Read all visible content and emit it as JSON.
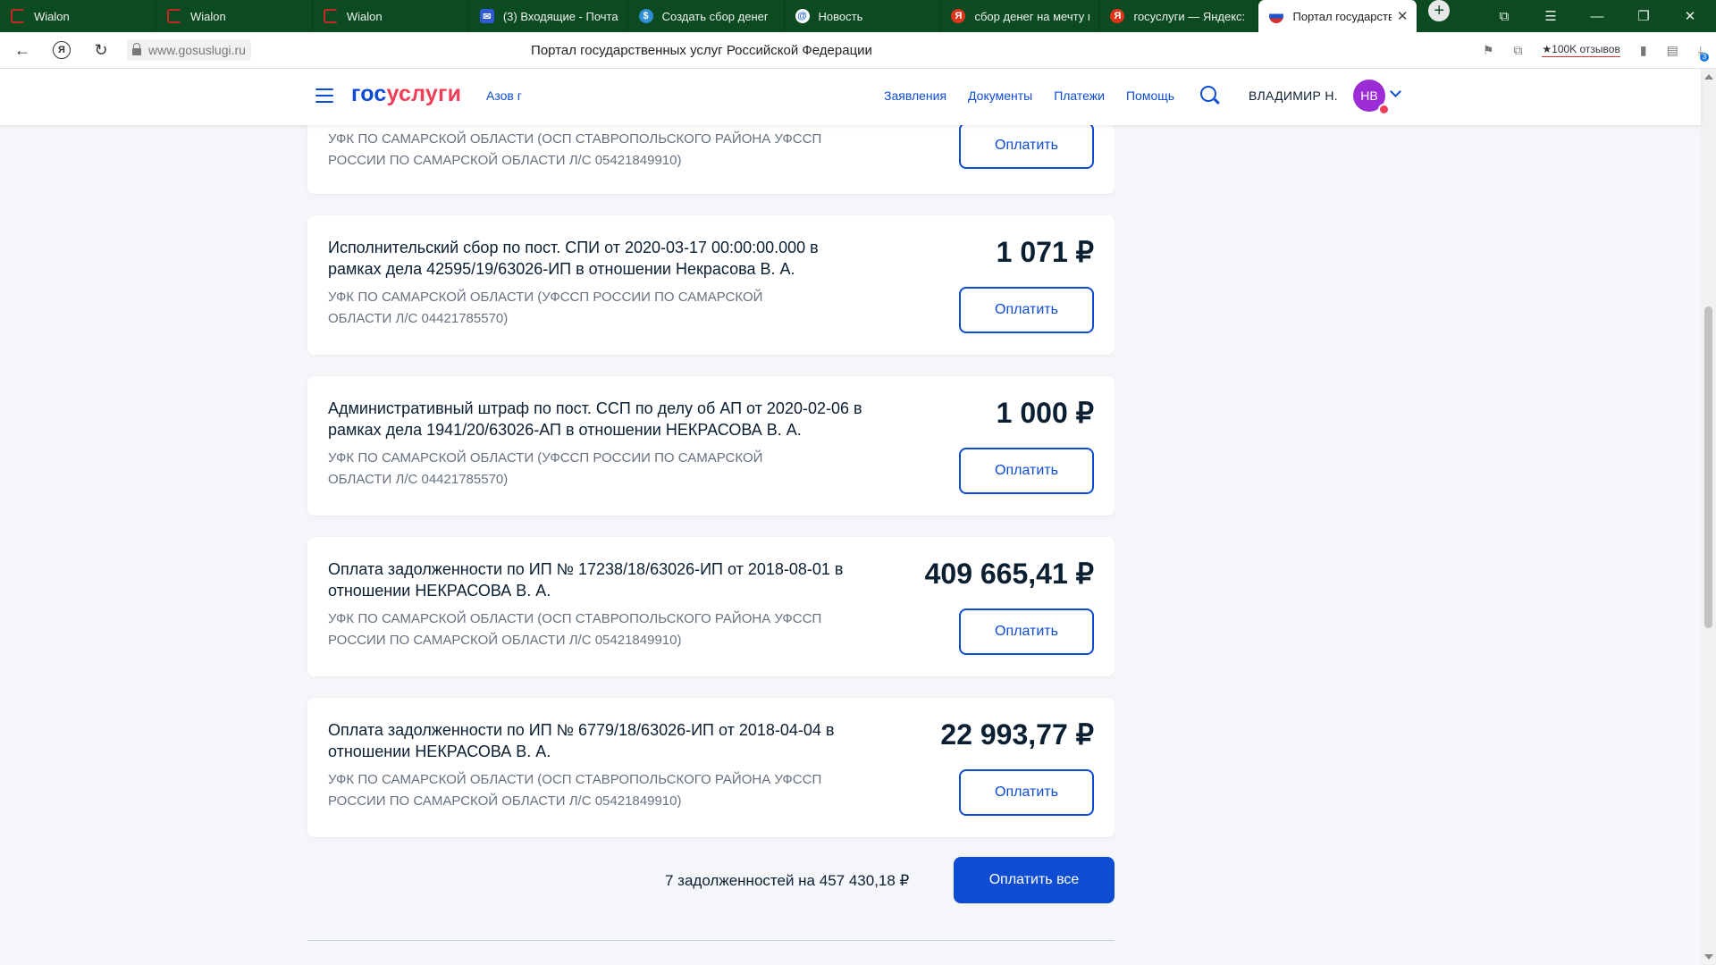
{
  "browser": {
    "tabs": [
      {
        "label": "Wialon",
        "icon": "wialon-icon"
      },
      {
        "label": "Wialon",
        "icon": "wialon-icon"
      },
      {
        "label": "Wialon",
        "icon": "wialon-icon"
      },
      {
        "label": "(3) Входящие - Почта",
        "icon": "mail-icon"
      },
      {
        "label": "Создать сбор денег",
        "icon": "donate-icon"
      },
      {
        "label": "Новость",
        "icon": "at-icon"
      },
      {
        "label": "сбор денег на мечту п",
        "icon": "yandex-icon"
      },
      {
        "label": "госуслуги — Яндекс: н",
        "icon": "yandex-icon"
      },
      {
        "label": "Портал государстве",
        "icon": "flag-icon",
        "active": true
      }
    ],
    "url": "www.gosuslugi.ru",
    "page_title": "Портал государственных услуг Российской Федерации",
    "reviews": "★100K отзывов",
    "downloads_count": "3"
  },
  "header": {
    "logo_part1": "гос",
    "logo_part2": "услуги",
    "location": "Азов г",
    "nav": [
      "Заявления",
      "Документы",
      "Платежи",
      "Помощь"
    ],
    "user_name": "ВЛАДИМИР Н.",
    "avatar_initials": "НВ"
  },
  "debts": [
    {
      "title": "",
      "recipient": "УФК ПО САМАРСКОЙ ОБЛАСТИ (ОСП СТАВРОПОЛЬСКОГО РАЙОНА УФССП РОССИИ ПО САМАРСКОЙ ОБЛАСТИ Л/С 05421849910)",
      "amount": "",
      "pay_label": "Оплатить"
    },
    {
      "title": "Исполнительский сбор по пост. СПИ от 2020-03-17 00:00:00.000 в рамках дела 42595/19/63026-ИП в отношении Некрасова В. А.",
      "recipient": "УФК ПО САМАРСКОЙ ОБЛАСТИ (УФССП РОССИИ ПО САМАРСКОЙ ОБЛАСТИ Л/С 04421785570)",
      "amount": "1 071 ₽",
      "pay_label": "Оплатить"
    },
    {
      "title": "Административный штраф по пост. ССП по делу об АП от 2020-02-06 в рамках дела 1941/20/63026-АП в отношении НЕКРАСОВА В. А.",
      "recipient": "УФК ПО САМАРСКОЙ ОБЛАСТИ (УФССП РОССИИ ПО САМАРСКОЙ ОБЛАСТИ Л/С 04421785570)",
      "amount": "1 000 ₽",
      "pay_label": "Оплатить"
    },
    {
      "title": "Оплата задолженности по ИП № 17238/18/63026-ИП от 2018-08-01 в отношении НЕКРАСОВА В. А.",
      "recipient": "УФК ПО САМАРСКОЙ ОБЛАСТИ (ОСП СТАВРОПОЛЬСКОГО РАЙОНА УФССП РОССИИ ПО САМАРСКОЙ ОБЛАСТИ Л/С 05421849910)",
      "amount": "409 665,41 ₽",
      "pay_label": "Оплатить"
    },
    {
      "title": "Оплата задолженности по ИП № 6779/18/63026-ИП от 2018-04-04 в отношении НЕКРАСОВА В. А.",
      "recipient": "УФК ПО САМАРСКОЙ ОБЛАСТИ (ОСП СТАВРОПОЛЬСКОГО РАЙОНА УФССП РОССИИ ПО САМАРСКОЙ ОБЛАСТИ Л/С 05421849910)",
      "amount": "22 993,77 ₽",
      "pay_label": "Оплатить"
    }
  ],
  "summary": {
    "text": "7 задолженностей на 457 430,18 ₽",
    "pay_all_label": "Оплатить все"
  },
  "colors": {
    "brand_blue": "#0d4cd3",
    "brand_red": "#ee3f58",
    "browser_frame": "#0c4a22",
    "avatar": "#9b2cd6"
  }
}
